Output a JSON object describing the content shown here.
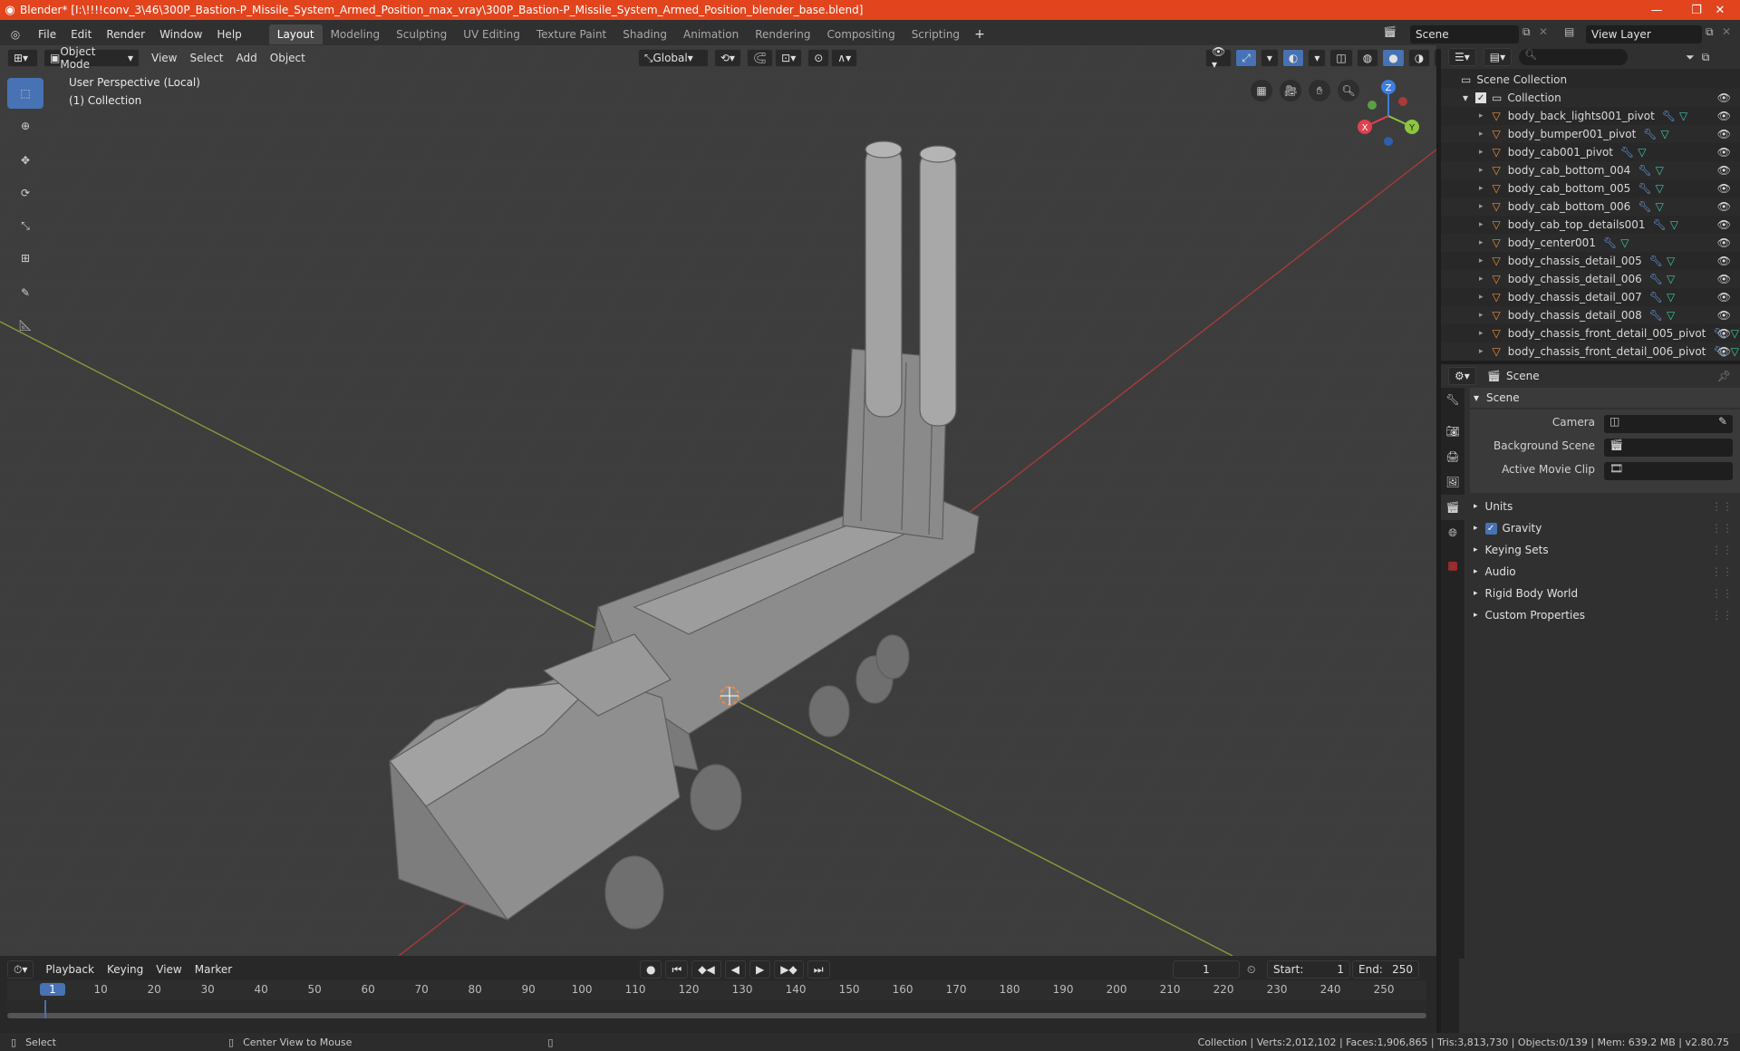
{
  "window": {
    "title": "Blender* [I:\\!!!!conv_3\\46\\300P_Bastion-P_Missile_System_Armed_Position_max_vray\\300P_Bastion-P_Missile_System_Armed_Position_blender_base.blend]",
    "minimize": "—",
    "maximize": "❐",
    "close": "✕"
  },
  "menu": [
    "File",
    "Edit",
    "Render",
    "Window",
    "Help"
  ],
  "workspaces": [
    "Layout",
    "Modeling",
    "Sculpting",
    "UV Editing",
    "Texture Paint",
    "Shading",
    "Animation",
    "Rendering",
    "Compositing",
    "Scripting"
  ],
  "active_workspace": "Layout",
  "add_workspace": "+",
  "scene_name": "Scene",
  "view_layer": "View Layer",
  "viewport": {
    "mode": "Object Mode",
    "menus": [
      "View",
      "Select",
      "Add",
      "Object"
    ],
    "orientation": "Global",
    "perspective_label": "User Perspective (Local)",
    "collection_label": "(1) Collection",
    "gizmo_axes": {
      "x": "X",
      "y": "Y",
      "z": "Z"
    }
  },
  "outliner": {
    "scene_collection": "Scene Collection",
    "collection": "Collection",
    "items": [
      "body_back_lights001_pivot",
      "body_bumper001_pivot",
      "body_cab001_pivot",
      "body_cab_bottom_004",
      "body_cab_bottom_005",
      "body_cab_bottom_006",
      "body_cab_top_details001",
      "body_center001",
      "body_chassis_detail_005",
      "body_chassis_detail_006",
      "body_chassis_detail_007",
      "body_chassis_detail_008",
      "body_chassis_front_detail_005_pivot",
      "body_chassis_front_detail_006_pivot"
    ]
  },
  "properties": {
    "context": "Scene",
    "section": "Scene",
    "camera_label": "Camera",
    "background_scene_label": "Background Scene",
    "active_movie_clip_label": "Active Movie Clip",
    "panels": [
      "Units",
      "Gravity",
      "Keying Sets",
      "Audio",
      "Rigid Body World",
      "Custom Properties"
    ],
    "gravity_checked": true
  },
  "timeline": {
    "menus": [
      "Playback",
      "Keying",
      "View",
      "Marker"
    ],
    "current_frame": "1",
    "start_label": "Start:",
    "start": "1",
    "end_label": "End:",
    "end": "250",
    "ticks": [
      "1",
      "10",
      "20",
      "30",
      "40",
      "50",
      "60",
      "70",
      "80",
      "90",
      "100",
      "110",
      "120",
      "130",
      "140",
      "150",
      "160",
      "170",
      "180",
      "190",
      "200",
      "210",
      "220",
      "230",
      "240",
      "250"
    ]
  },
  "status": {
    "select": "Select",
    "center_view": "Center View to Mouse",
    "stats": "Collection | Verts:2,012,102 | Faces:1,906,865 | Tris:3,813,730 | Objects:0/139 | Mem: 639.2 MB | v2.80.75"
  },
  "colors": {
    "title_bar": "#e2451e",
    "accent": "#4772b3",
    "object_icon": "#e8923a",
    "axis_x": "#e0414f",
    "axis_y": "#8cc63f",
    "axis_z": "#3d7ee0"
  }
}
